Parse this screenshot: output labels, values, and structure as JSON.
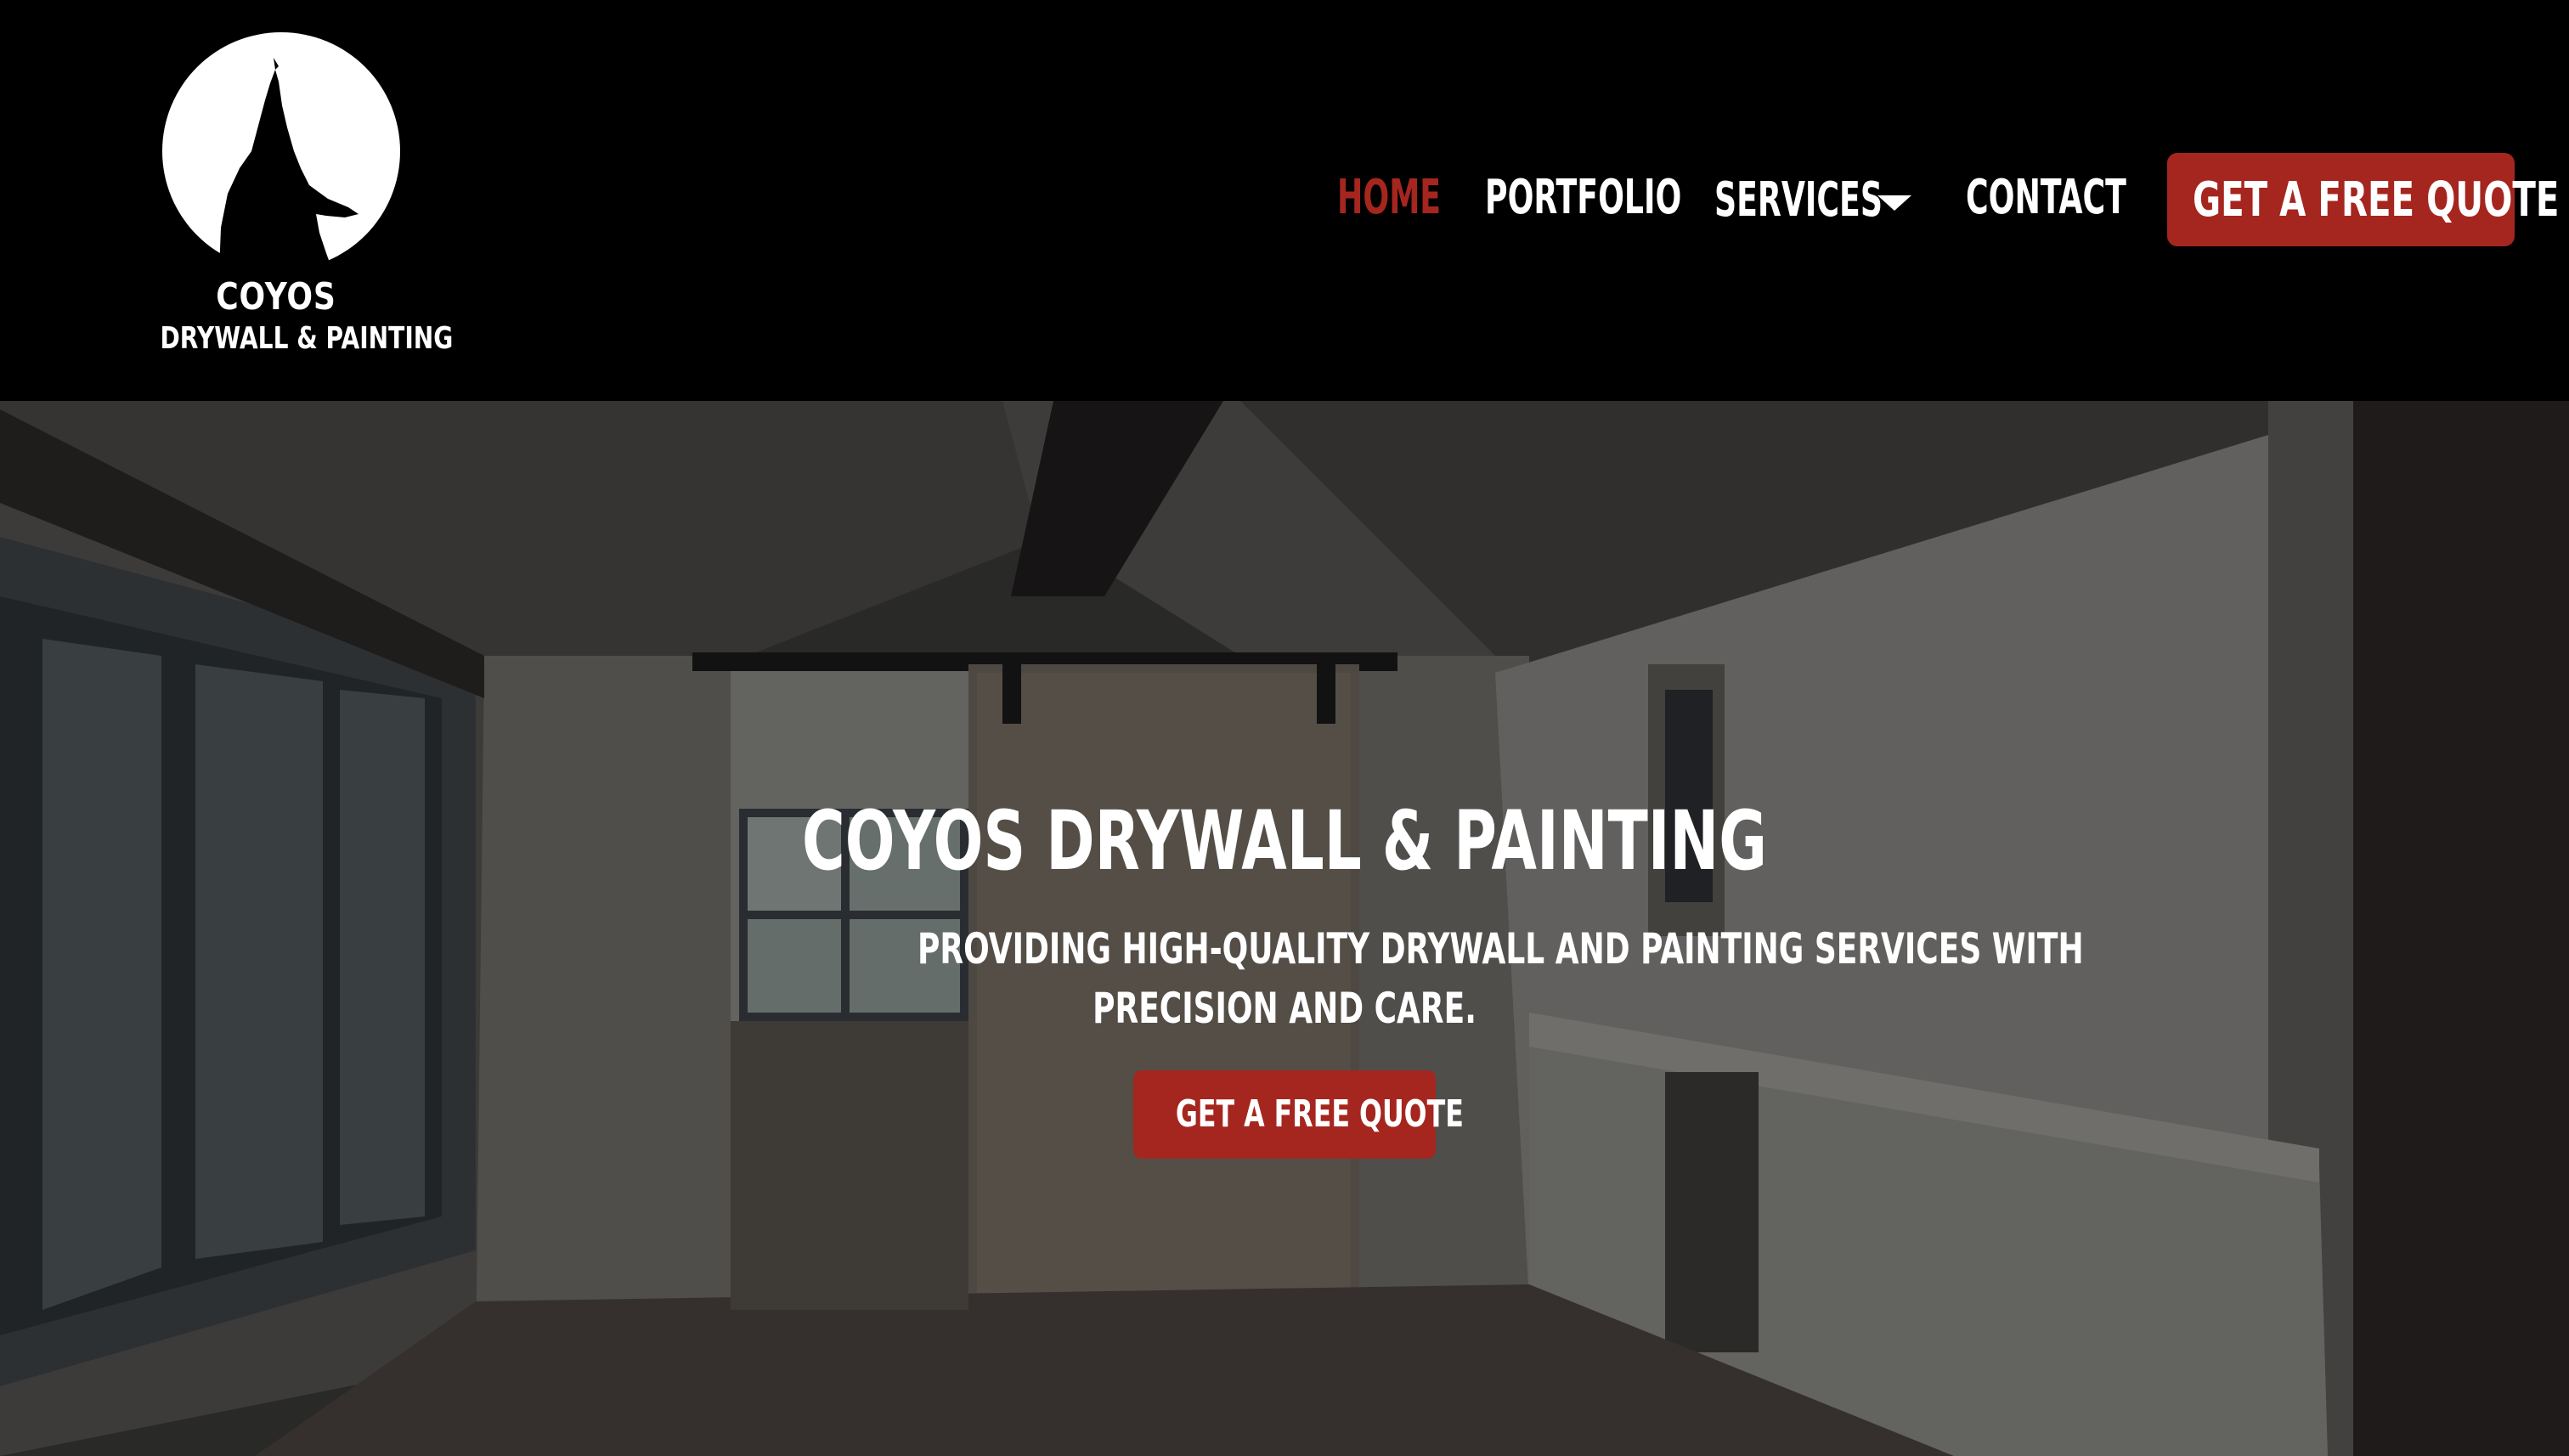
{
  "brand": {
    "name": "COYOS",
    "tagline": "DRYWALL & PAINTING",
    "logo_icon": "howling-coyote-moon-icon"
  },
  "nav": {
    "home": "HOME",
    "portfolio": "PORTFOLIO",
    "services": "SERVICES",
    "contact": "CONTACT",
    "cta": "GET A FREE QUOTE",
    "active_item": "HOME",
    "services_icon": "chevron-down-icon"
  },
  "hero": {
    "title": "COYOS DRYWALL & PAINTING",
    "subtitle_line1": "PROVIDING HIGH-QUALITY DRYWALL AND PAINTING SERVICES WITH",
    "subtitle_line2": "PRECISION AND CARE.",
    "cta": "GET A FREE QUOTE",
    "background": "interior room with barn door, windows and cabinets (darkened)"
  },
  "colors": {
    "header_bg": "#000000",
    "accent": "#a5261f",
    "text": "#ffffff"
  }
}
